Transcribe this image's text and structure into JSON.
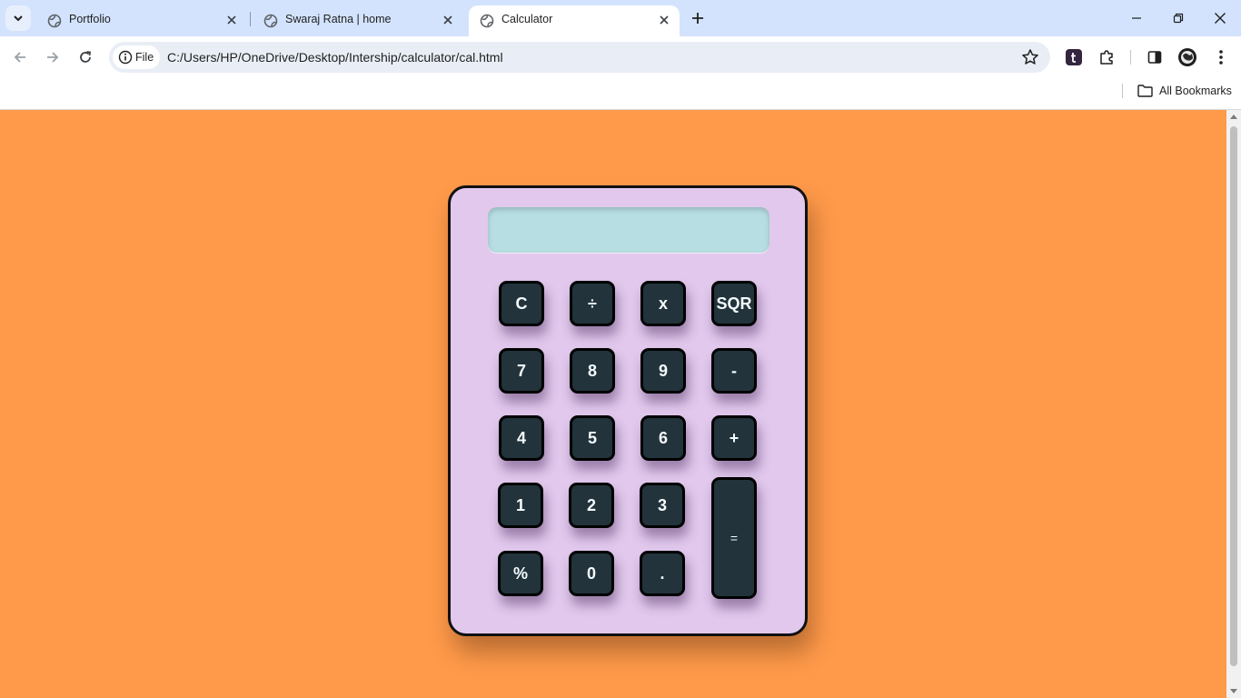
{
  "browser": {
    "tabs": [
      {
        "title": "Portfolio",
        "active": false
      },
      {
        "title": "Swaraj Ratna | home",
        "active": false
      },
      {
        "title": "Calculator",
        "active": true
      }
    ],
    "site_chip": "File",
    "url": "C:/Users/HP/OneDrive/Desktop/Intership/calculator/cal.html",
    "bookmarks_label": "All Bookmarks"
  },
  "page": {
    "background": "#ff9a4a"
  },
  "calculator": {
    "display_value": "",
    "colors": {
      "body": "#e1c8ec",
      "display": "#b7dfe3",
      "key": "#22333b",
      "key_text": "#f4fbfd"
    },
    "keys": {
      "clear": "C",
      "divide": "÷",
      "multiply": "x",
      "sqr": "SQR",
      "seven": "7",
      "eight": "8",
      "nine": "9",
      "minus": "-",
      "four": "4",
      "five": "5",
      "six": "6",
      "plus": "+",
      "one": "1",
      "two": "2",
      "three": "3",
      "equals": "=",
      "percent": "%",
      "zero": "0",
      "decimal": "."
    }
  }
}
